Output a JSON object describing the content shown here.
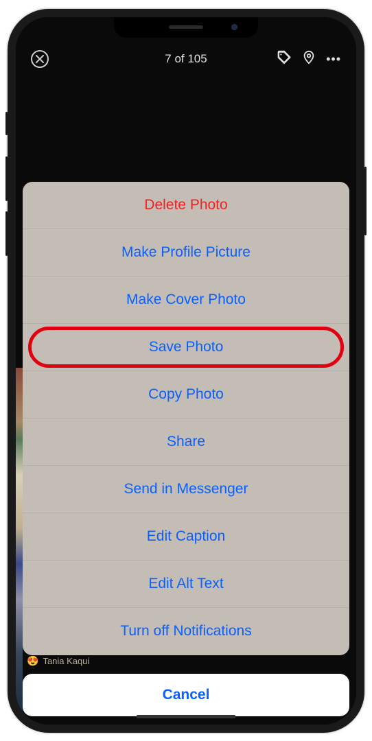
{
  "header": {
    "counter": "7 of 105"
  },
  "likes": {
    "name": "Tania Kaqui"
  },
  "sheet": {
    "items": [
      {
        "label": "Delete Photo",
        "destructive": true,
        "key": "delete-photo"
      },
      {
        "label": "Make Profile Picture",
        "destructive": false,
        "key": "make-profile-picture"
      },
      {
        "label": "Make Cover Photo",
        "destructive": false,
        "key": "make-cover-photo"
      },
      {
        "label": "Save Photo",
        "destructive": false,
        "key": "save-photo",
        "highlighted": true
      },
      {
        "label": "Copy Photo",
        "destructive": false,
        "key": "copy-photo"
      },
      {
        "label": "Share",
        "destructive": false,
        "key": "share"
      },
      {
        "label": "Send in Messenger",
        "destructive": false,
        "key": "send-in-messenger"
      },
      {
        "label": "Edit Caption",
        "destructive": false,
        "key": "edit-caption"
      },
      {
        "label": "Edit Alt Text",
        "destructive": false,
        "key": "edit-alt-text"
      },
      {
        "label": "Turn off Notifications",
        "destructive": false,
        "key": "turn-off-notifications"
      }
    ],
    "cancel": "Cancel"
  }
}
